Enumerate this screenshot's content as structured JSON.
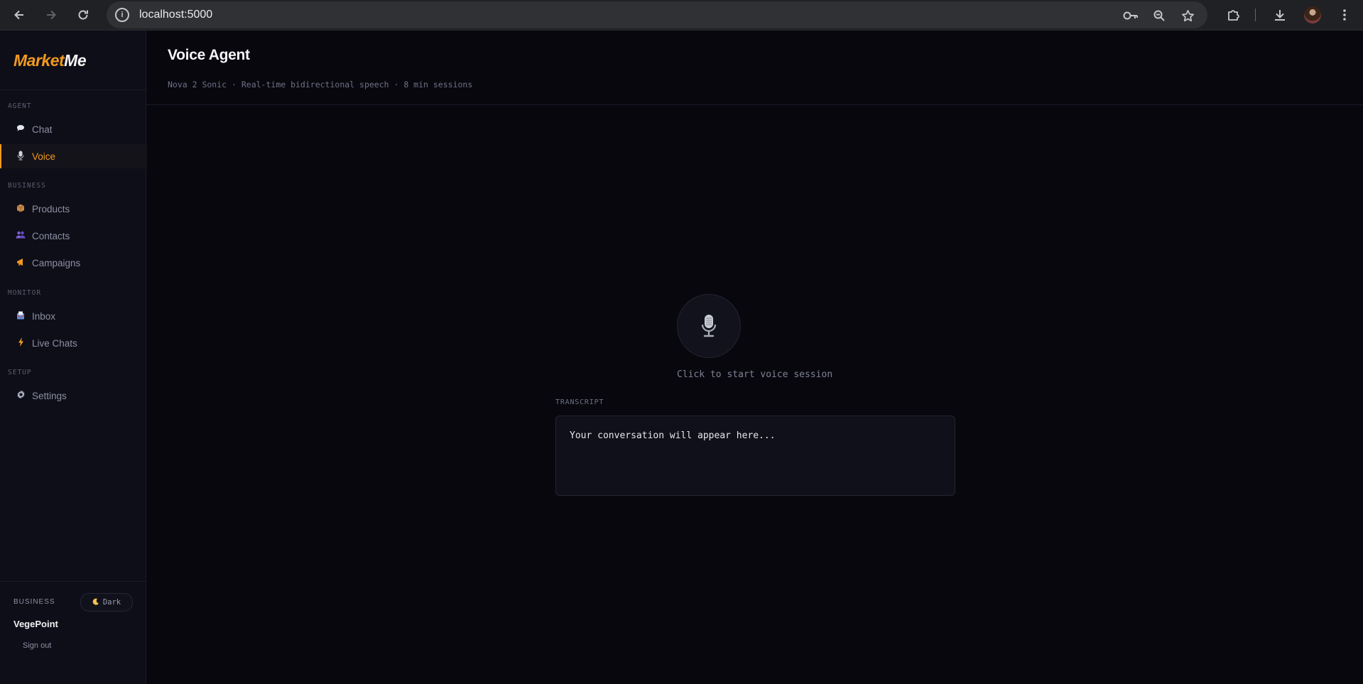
{
  "browser": {
    "url": "localhost:5000",
    "back_icon": "arrow-left-icon",
    "forward_icon": "arrow-right-icon",
    "reload_icon": "reload-icon",
    "site_info_icon": "info-icon",
    "password_icon": "key-icon",
    "zoom_icon": "zoom-icon",
    "bookmark_icon": "star-icon",
    "extensions_icon": "puzzle-icon",
    "download_icon": "download-icon",
    "menu_icon": "kebab-menu-icon"
  },
  "app": {
    "logo_part1": "Market",
    "logo_part2": "Me",
    "brand_color": "#f29a1f",
    "sidebar": {
      "sections": [
        {
          "label": "AGENT"
        },
        {
          "label": "BUSINESS"
        },
        {
          "label": "MONITOR"
        },
        {
          "label": "SETUP"
        }
      ],
      "items": [
        {
          "label": "Chat",
          "icon": "speech-bubble-icon",
          "active": false
        },
        {
          "label": "Voice",
          "icon": "microphone-icon",
          "active": true
        },
        {
          "label": "Products",
          "icon": "package-icon",
          "active": false
        },
        {
          "label": "Contacts",
          "icon": "people-icon",
          "active": false
        },
        {
          "label": "Campaigns",
          "icon": "megaphone-icon",
          "active": false
        },
        {
          "label": "Inbox",
          "icon": "inbox-icon",
          "active": false
        },
        {
          "label": "Live Chats",
          "icon": "lightning-icon",
          "active": false
        },
        {
          "label": "Settings",
          "icon": "gear-icon",
          "active": false
        }
      ],
      "footer": {
        "business_label": "BUSINESS",
        "theme_toggle": "Dark",
        "business_name": "VegePoint",
        "sign_out": "Sign out"
      }
    },
    "main": {
      "title": "Voice Agent",
      "subtitle": "Nova 2 Sonic · Real-time bidirectional speech · 8 min sessions",
      "hint": "Click to start voice session",
      "transcript_label": "TRANSCRIPT",
      "transcript_placeholder": "Your conversation will appear here..."
    }
  }
}
